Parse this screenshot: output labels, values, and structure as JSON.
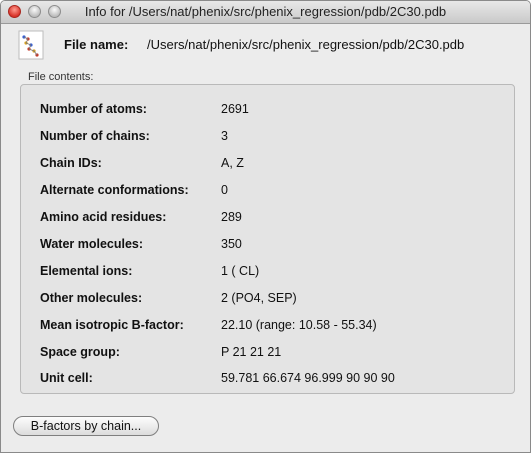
{
  "window": {
    "title": "Info for /Users/nat/phenix/src/phenix_regression/pdb/2C30.pdb"
  },
  "file": {
    "label": "File name:",
    "value": "/Users/nat/phenix/src/phenix_regression/pdb/2C30.pdb",
    "icon": "pdb-file-icon"
  },
  "contents": {
    "section_label": "File contents:",
    "rows": [
      {
        "label": "Number of atoms:",
        "value": "2691"
      },
      {
        "label": "Number of chains:",
        "value": "3"
      },
      {
        "label": "Chain IDs:",
        "value": "A, Z"
      },
      {
        "label": "Alternate conformations:",
        "value": "0"
      },
      {
        "label": "Amino acid residues:",
        "value": "289"
      },
      {
        "label": "Water molecules:",
        "value": "350"
      },
      {
        "label": "Elemental ions:",
        "value": "1 ( CL)"
      },
      {
        "label": "Other molecules:",
        "value": "2 (PO4, SEP)"
      },
      {
        "label": "Mean isotropic B-factor:",
        "value": "22.10 (range: 10.58 - 55.34)"
      },
      {
        "label": "Space group:",
        "value": "P 21 21 21"
      },
      {
        "label": "Unit cell:",
        "value": "59.781 66.674 96.999 90 90 90"
      }
    ]
  },
  "actions": {
    "bfactors_label": "B-factors by chain..."
  }
}
